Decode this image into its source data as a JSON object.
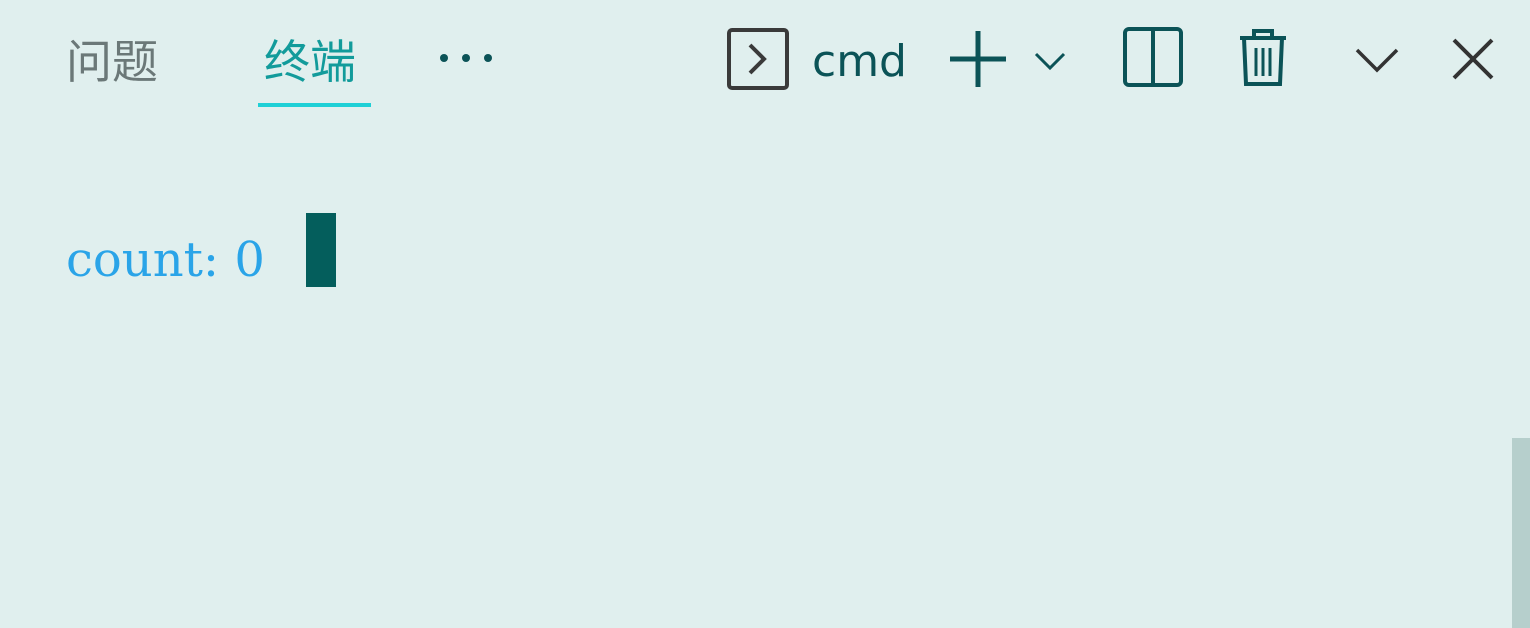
{
  "tabs": {
    "problems_label": "问题",
    "terminal_label": "终端"
  },
  "toolbar": {
    "shell_name": "cmd",
    "more_icon": "ellipsis-icon",
    "shell_icon": "terminal-prompt-icon",
    "new_icon": "plus-icon",
    "profile_icon": "chevron-down-icon",
    "split_icon": "split-panel-icon",
    "kill_icon": "trash-icon",
    "maximize_icon": "chevron-down-icon",
    "close_icon": "close-icon"
  },
  "terminal": {
    "output": "count: 0"
  },
  "colors": {
    "background": "#e0efee",
    "active_tab": "#129b9b",
    "inactive_tab": "#6b7878",
    "underline": "#1fd0d6",
    "icon": "#0b5357",
    "output_text": "#2aa4e8",
    "cursor": "#045e5c"
  }
}
